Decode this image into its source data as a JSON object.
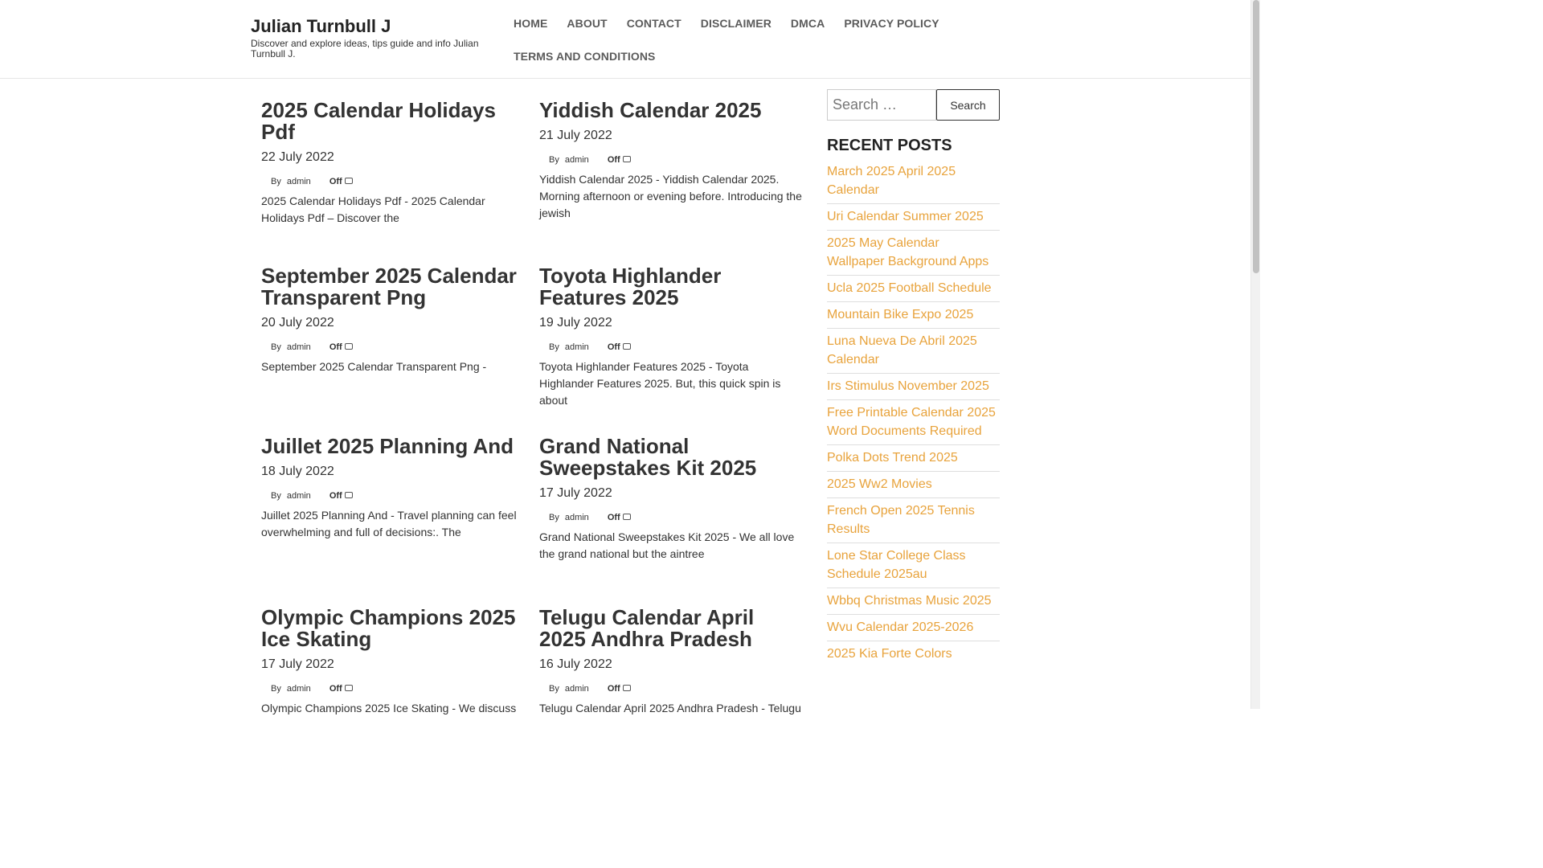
{
  "site": {
    "title": "Julian Turnbull J",
    "description": "Discover and explore ideas, tips guide and info Julian Turnbull J."
  },
  "nav": {
    "items": [
      {
        "label": "HOME"
      },
      {
        "label": "ABOUT"
      },
      {
        "label": "CONTACT"
      },
      {
        "label": "DISCLAIMER"
      },
      {
        "label": "DMCA"
      },
      {
        "label": "PRIVACY POLICY"
      },
      {
        "label": "TERMS AND CONDITIONS"
      }
    ]
  },
  "posts": [
    {
      "title": "2025 Calendar Holidays Pdf",
      "date": "22 July 2022",
      "by": "By",
      "author": "admin",
      "comments": "Off",
      "excerpt": "2025 Calendar Holidays Pdf - 2025 Calendar Holidays Pdf – Discover the"
    },
    {
      "title": "Yiddish Calendar 2025",
      "date": "21 July 2022",
      "by": "By",
      "author": "admin",
      "comments": "Off",
      "excerpt": "Yiddish Calendar 2025 - Yiddish Calendar 2025. Morning afternoon or evening before. Introducing the jewish"
    },
    {
      "title": "September 2025 Calendar Transparent Png",
      "date": "20 July 2022",
      "by": "By",
      "author": "admin",
      "comments": "Off",
      "excerpt": "September 2025 Calendar Transparent Png -"
    },
    {
      "title": "Toyota Highlander Features 2025",
      "date": "19 July 2022",
      "by": "By",
      "author": "admin",
      "comments": "Off",
      "excerpt": "Toyota Highlander Features 2025 - Toyota Highlander Features 2025. But, this quick spin is about"
    },
    {
      "title": "Juillet 2025 Planning And",
      "date": "18 July 2022",
      "by": "By",
      "author": "admin",
      "comments": "Off",
      "excerpt": "Juillet 2025 Planning And - Travel planning can feel overwhelming and full of decisions:. The"
    },
    {
      "title": "Grand National Sweepstakes Kit 2025",
      "date": "17 July 2022",
      "by": "By",
      "author": "admin",
      "comments": "Off",
      "excerpt": "Grand National Sweepstakes Kit 2025 - We all love the grand national but the aintree"
    },
    {
      "title": "Olympic Champions 2025 Ice Skating",
      "date": "17 July 2022",
      "by": "By",
      "author": "admin",
      "comments": "Off",
      "excerpt": "Olympic Champions 2025 Ice Skating - We discuss"
    },
    {
      "title": "Telugu Calendar April 2025 Andhra Pradesh",
      "date": "16 July 2022",
      "by": "By",
      "author": "admin",
      "comments": "Off",
      "excerpt": "Telugu Calendar April 2025 Andhra Pradesh - Telugu"
    }
  ],
  "sidebar": {
    "search_placeholder": "Search …",
    "search_button": "Search",
    "recent_title": "RECENT POSTS",
    "recent_posts": [
      {
        "label": "March 2025 April 2025 Calendar"
      },
      {
        "label": "Uri Calendar Summer 2025"
      },
      {
        "label": "2025 May Calendar Wallpaper Background Apps"
      },
      {
        "label": "Ucla 2025 Football Schedule"
      },
      {
        "label": "Mountain Bike Expo 2025"
      },
      {
        "label": "Luna Nueva De Abril 2025 Calendar"
      },
      {
        "label": "Irs Stimulus November 2025"
      },
      {
        "label": "Free Printable Calendar 2025 Word Documents Required"
      },
      {
        "label": "Polka Dots Trend 2025"
      },
      {
        "label": "2025 Ww2 Movies"
      },
      {
        "label": "French Open 2025 Tennis Results"
      },
      {
        "label": "Lone Star College Class Schedule 2025au"
      },
      {
        "label": "Wbbq Christmas Music 2025"
      },
      {
        "label": "Wvu Calendar 2025-2026"
      },
      {
        "label": "2025 Kia Forte Colors"
      }
    ]
  },
  "colors": {
    "link_accent": "#e8a33c",
    "text": "#333333",
    "nav_text": "#5b5b5b"
  }
}
